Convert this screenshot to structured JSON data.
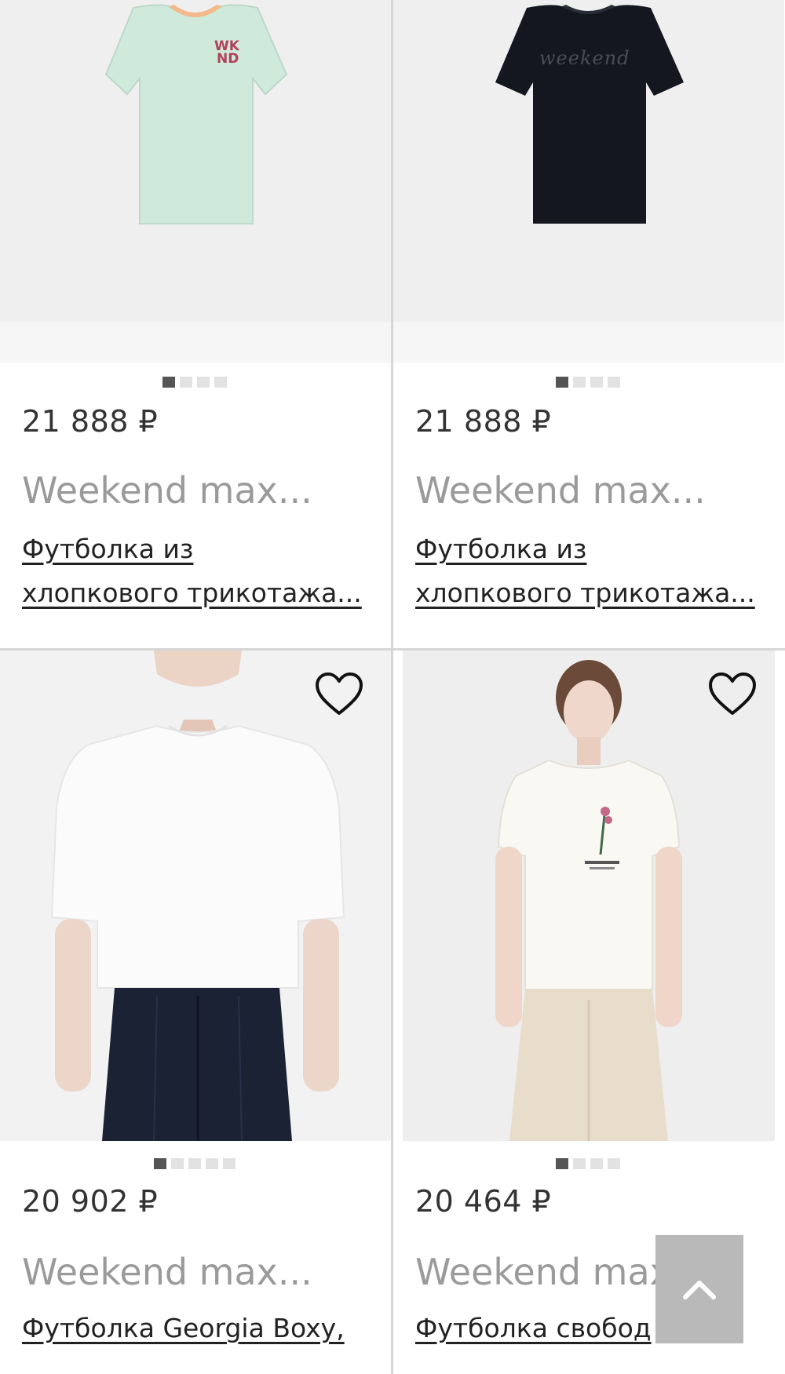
{
  "products": [
    {
      "price": "21 888 ₽",
      "brand": "Weekend max...",
      "title_line1": "Футболка из",
      "title_line2": "хлопкового трикотажа...",
      "image": "mint-tshirt-wknd-print",
      "dots": 4,
      "active_dot": 1,
      "favorite": false
    },
    {
      "price": "21 888 ₽",
      "brand": "Weekend max...",
      "title_line1": "Футболка из",
      "title_line2": "хлопкового трикотажа...",
      "image": "black-tshirt-sequin-logo",
      "dots": 4,
      "active_dot": 1,
      "favorite": false
    },
    {
      "price": "20 902 ₽",
      "brand": "Weekend max...",
      "title_line1": "Футболка Georgia Boxy,",
      "image": "model-white-boxy-tshirt-navy-trousers",
      "dots": 5,
      "active_dot": 1,
      "favorite": true
    },
    {
      "price": "20 464 ₽",
      "brand": "Weekend max...",
      "title_line1": "Футболка свобод",
      "image": "model-white-tshirt-flower-print-beige-trousers",
      "dots": 4,
      "active_dot": 1,
      "favorite": true
    }
  ],
  "icons": {
    "favorite": "heart-outline-icon",
    "scroll_top": "chevron-up-icon"
  },
  "colors": {
    "background": "#ffffff",
    "divider": "#d6d6d6",
    "brand_text": "#9a9a9a",
    "dot_active": "#555555",
    "dot_inactive": "#e2e2e2",
    "scroll_button": "#b9b9b9"
  }
}
